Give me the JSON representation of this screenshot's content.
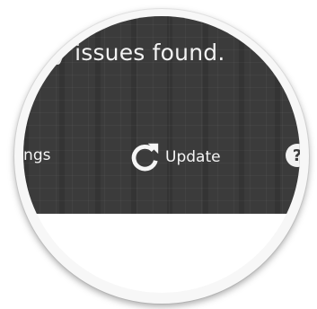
{
  "status": {
    "message": "cy issues found."
  },
  "toolbar": {
    "settings_label": "ttings",
    "update_label": "Update",
    "help_symbol": "?"
  },
  "icons": {
    "update": "refresh-icon",
    "help": "help-icon"
  },
  "colors": {
    "panel_bg": "#3b3b3b",
    "text": "#f2f2f2",
    "lower_bg": "#ffffff"
  }
}
